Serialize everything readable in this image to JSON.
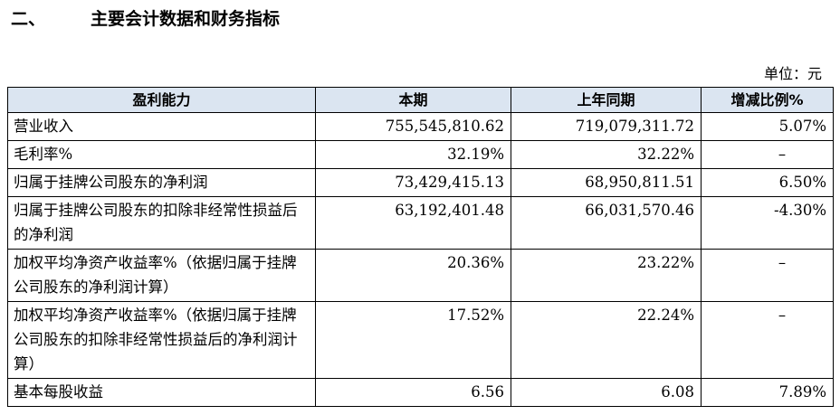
{
  "heading": {
    "number": "二、",
    "title": "主要会计数据和财务指标"
  },
  "unit": "单位：元",
  "table": {
    "headers": [
      "盈利能力",
      "本期",
      "上年同期",
      "增减比例%"
    ],
    "rows": [
      [
        "营业收入",
        "755,545,810.62",
        "719,079,311.72",
        "5.07%"
      ],
      [
        "毛利率%",
        "32.19%",
        "32.22%",
        "–"
      ],
      [
        "归属于挂牌公司股东的净利润",
        "73,429,415.13",
        "68,950,811.51",
        "6.50%"
      ],
      [
        "归属于挂牌公司股东的扣除非经常性损益后的净利润",
        "63,192,401.48",
        "66,031,570.46",
        "-4.30%"
      ],
      [
        "加权平均净资产收益率%（依据归属于挂牌公司股东的净利润计算）",
        "20.36%",
        "23.22%",
        "–"
      ],
      [
        "加权平均净资产收益率%（依据归属于挂牌公司股东的扣除非经常性损益后的净利润计算）",
        "17.52%",
        "22.24%",
        "–"
      ],
      [
        "基本每股收益",
        "6.56",
        "6.08",
        "7.89%"
      ]
    ]
  }
}
